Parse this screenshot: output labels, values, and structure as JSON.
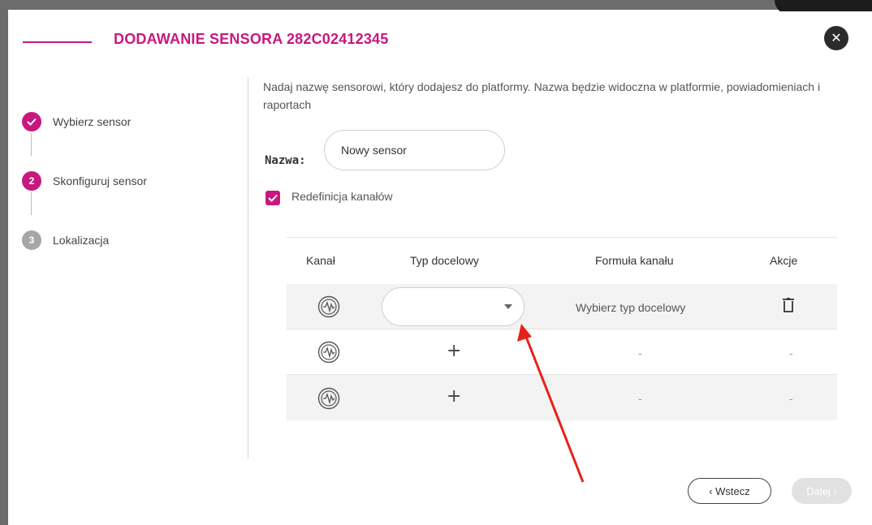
{
  "modal": {
    "title": "DODAWANIE SENSORA 282C02412345",
    "close_glyph": "✕"
  },
  "steps": [
    {
      "number": "✓",
      "label": "Wybierz sensor",
      "state": "done"
    },
    {
      "number": "2",
      "label": "Skonfiguruj sensor",
      "state": "active"
    },
    {
      "number": "3",
      "label": "Lokalizacja",
      "state": "todo"
    }
  ],
  "form": {
    "description": "Nadaj nazwę sensorowi, który dodajesz do platformy. Nazwa będzie widoczna w platformie, powiadomieniach i raportach",
    "name_label": "Nazwa:",
    "name_value": "Nowy sensor",
    "redefine_label": "Redefinicja kanałów",
    "redefine_checked": true
  },
  "table": {
    "headers": {
      "channel": "Kanał",
      "target_type": "Typ docelowy",
      "formula": "Formuła kanału",
      "actions": "Akcje"
    },
    "rows": [
      {
        "channel_icon": "waveform-icon",
        "target_type": "",
        "formula": "Wybierz typ docelowy",
        "actions": "trash-icon"
      },
      {
        "channel_icon": "waveform-icon",
        "target_type": "+",
        "formula": "-",
        "actions": "-"
      },
      {
        "channel_icon": "waveform-icon",
        "target_type": "+",
        "formula": "-",
        "actions": "-"
      }
    ]
  },
  "footer": {
    "back_label": "‹ Wstecz",
    "next_label": "Dalej ›"
  },
  "colors": {
    "accent": "#c8177f",
    "annotation_arrow": "#e8201a",
    "disabled": "#e1e1e1"
  }
}
